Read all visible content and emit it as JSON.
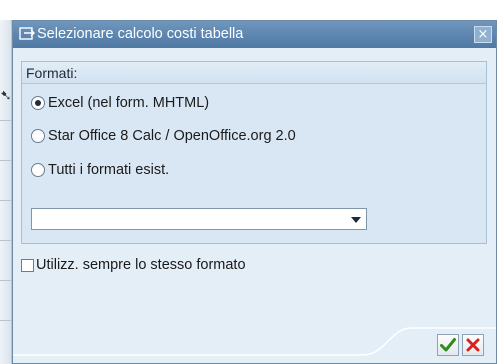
{
  "dialog": {
    "title": "Selezionare calcolo costi tabella",
    "close_label": "×"
  },
  "formats": {
    "header": "Formati:",
    "options": [
      {
        "label": "Excel (nel form. MHTML)",
        "selected": true
      },
      {
        "label": "Star Office 8 Calc / OpenOffice.org 2.0",
        "selected": false
      },
      {
        "label": "Tutti i formati esist.",
        "selected": false
      }
    ],
    "dropdown_value": ""
  },
  "always_same_format": {
    "label": "Utilizz. sempre lo stesso formato",
    "checked": false
  },
  "colors": {
    "titlebar": "#5a82ad",
    "dialog_bg": "#e4eef7",
    "confirm_icon": "#2e8b1e",
    "cancel_icon": "#d2231c"
  },
  "icons": {
    "title": "dialog-arrow-icon",
    "confirm": "checkmark-icon",
    "cancel": "cancel-x-icon"
  }
}
